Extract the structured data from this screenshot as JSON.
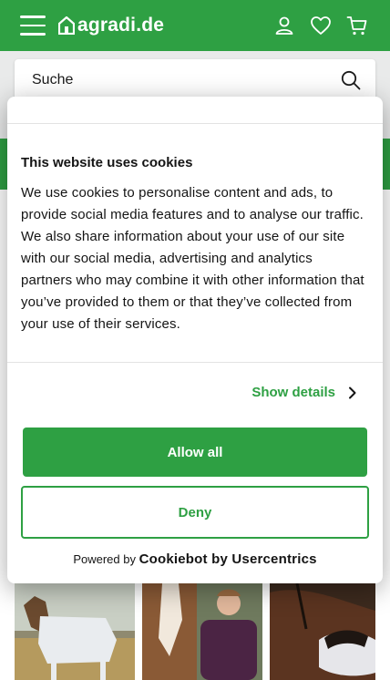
{
  "header": {
    "brand": "agradi.de",
    "accent_color": "#2ea043",
    "icons": [
      "menu-icon",
      "user-icon",
      "heart-icon",
      "cart-icon"
    ]
  },
  "search": {
    "placeholder": "Suche"
  },
  "cookie_banner": {
    "title": "This website uses cookies",
    "body": "We use cookies to personalise content and ads, to provide social media features and to analyse our traffic. We also share information about your use of our site with our social media, advertising and analytics partners who may combine it with other information that you’ve provided to them or that they’ve collected from your use of their services.",
    "show_details": "Show details",
    "allow_all": "Allow all",
    "deny": "Deny",
    "powered_by": "Powered by",
    "powered_brand": "Cookiebot by Usercentrics"
  }
}
